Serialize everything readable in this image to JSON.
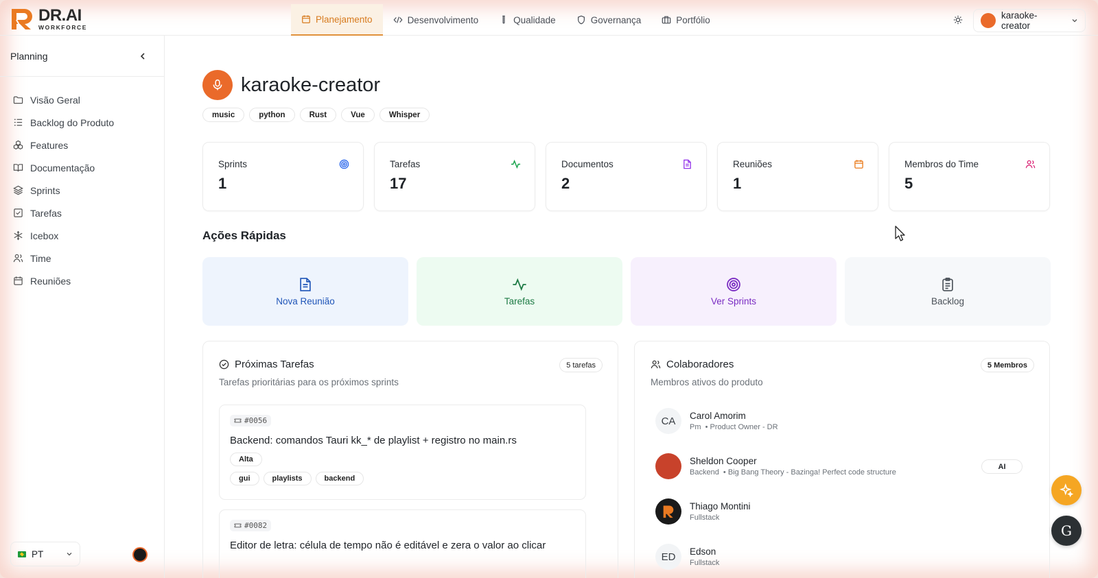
{
  "brand": {
    "name": "DR.AI",
    "sub": "WORKFORCE"
  },
  "nav": [
    {
      "label": "Planejamento",
      "icon": "calendar-icon"
    },
    {
      "label": "Desenvolvimento",
      "icon": "code-icon"
    },
    {
      "label": "Qualidade",
      "icon": "test-tube-icon"
    },
    {
      "label": "Governança",
      "icon": "shield-icon"
    },
    {
      "label": "Portfólio",
      "icon": "briefcase-icon"
    }
  ],
  "project_switch": {
    "label": "karaoke-creator"
  },
  "sidebar": {
    "title": "Planning",
    "items": [
      {
        "label": "Visão Geral"
      },
      {
        "label": "Backlog do Produto"
      },
      {
        "label": "Features"
      },
      {
        "label": "Documentação"
      },
      {
        "label": "Sprints"
      },
      {
        "label": "Tarefas"
      },
      {
        "label": "Icebox"
      },
      {
        "label": "Time"
      },
      {
        "label": "Reuniões"
      }
    ],
    "lang": "PT"
  },
  "project": {
    "title": "karaoke-creator",
    "tags": [
      "music",
      "python",
      "Rust",
      "Vue",
      "Whisper"
    ]
  },
  "stats": [
    {
      "label": "Sprints",
      "value": "1",
      "color": "#2563eb"
    },
    {
      "label": "Tarefas",
      "value": "17",
      "color": "#16a34a"
    },
    {
      "label": "Documentos",
      "value": "2",
      "color": "#9333ea"
    },
    {
      "label": "Reuniões",
      "value": "1",
      "color": "#ea7a1a"
    },
    {
      "label": "Membros do Time",
      "value": "5",
      "color": "#db2777"
    }
  ],
  "quick_actions": {
    "title": "Ações Rápidas",
    "items": [
      {
        "label": "Nova Reunião"
      },
      {
        "label": "Tarefas"
      },
      {
        "label": "Ver Sprints"
      },
      {
        "label": "Backlog"
      }
    ]
  },
  "next_tasks": {
    "title": "Próximas Tarefas",
    "badge": "5 tarefas",
    "subtitle": "Tarefas prioritárias para os próximos sprints",
    "tasks": [
      {
        "id": "#0056",
        "title": "Backend: comandos Tauri kk_* de playlist + registro no main.rs",
        "priority": "Alta",
        "tags": [
          "gui",
          "playlists",
          "backend"
        ]
      },
      {
        "id": "#0082",
        "title": "Editor de letra: célula de tempo não é editável e zera o valor ao clicar"
      }
    ]
  },
  "collaborators": {
    "title": "Colaboradores",
    "badge": "5 Membros",
    "subtitle": "Membros ativos do produto",
    "members": [
      {
        "initials": "CA",
        "name": "Carol Amorim",
        "role": "Pm",
        "detail": "Product Owner - DR"
      },
      {
        "name": "Sheldon Cooper",
        "role": "Backend",
        "detail": "Big Bang Theory - Bazinga! Perfect code structure",
        "badge": "AI"
      },
      {
        "name": "Thiago Montini",
        "role": "Fullstack"
      },
      {
        "initials": "ED",
        "name": "Edson",
        "role": "Fullstack"
      }
    ]
  },
  "fab": {
    "g_label": "G"
  }
}
